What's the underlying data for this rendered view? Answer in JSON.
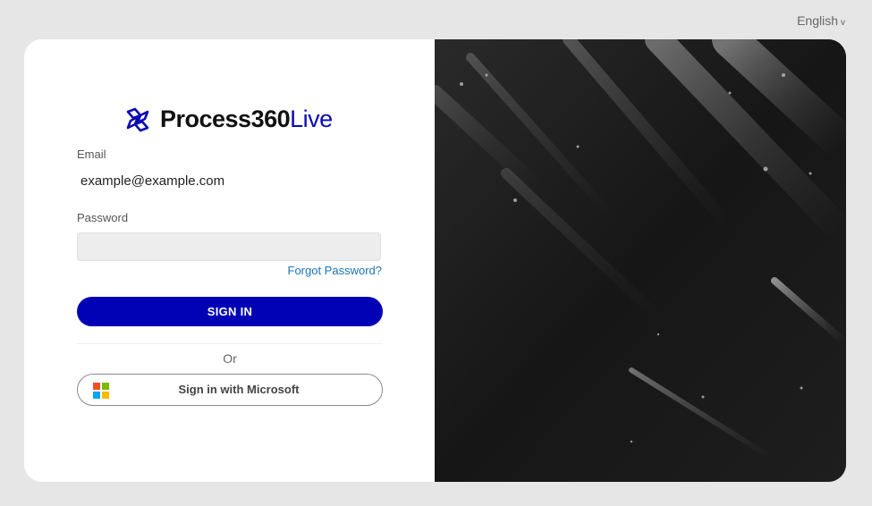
{
  "language": {
    "label": "English",
    "chevron": "v"
  },
  "logo": {
    "brand": "Process360",
    "suffix": "Live",
    "icon": "process360-logo-icon"
  },
  "form": {
    "email_label": "Email",
    "email_value": "example@example.com",
    "password_label": "Password",
    "password_value": "",
    "forgot_label": "Forgot Password?",
    "signin_label": "SIGN IN",
    "or_label": "Or",
    "microsoft_label": "Sign in with Microsoft"
  },
  "colors": {
    "brand": "#0101b6",
    "link": "#1a73b8",
    "ms_red": "#f25022",
    "ms_green": "#7fba00",
    "ms_blue": "#00a4ef",
    "ms_yellow": "#ffb900"
  }
}
